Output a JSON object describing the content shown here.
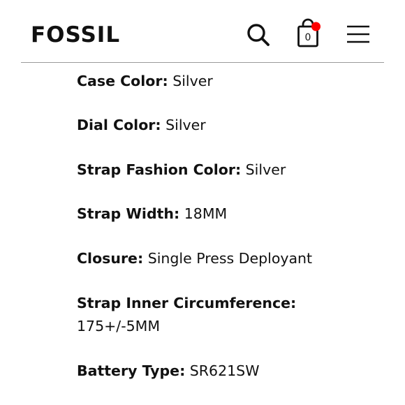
{
  "header": {
    "logo": "FOSSIL",
    "bag_count": "0",
    "icons": {
      "search": "search-icon",
      "bag": "shopping-bag-icon",
      "menu": "hamburger-menu-icon"
    },
    "notification_dot_color": "#ff0000"
  },
  "specs": [
    {
      "label": "Case Color:",
      "value": "Silver"
    },
    {
      "label": "Dial Color:",
      "value": "Silver"
    },
    {
      "label": "Strap Fashion Color:",
      "value": "Silver"
    },
    {
      "label": "Strap Width:",
      "value": "18MM"
    },
    {
      "label": "Closure:",
      "value": "Single Press Deployant"
    },
    {
      "label": "Strap Inner Circumference:",
      "value": "175+/-5MM"
    },
    {
      "label": "Battery Type:",
      "value": "SR621SW"
    }
  ]
}
